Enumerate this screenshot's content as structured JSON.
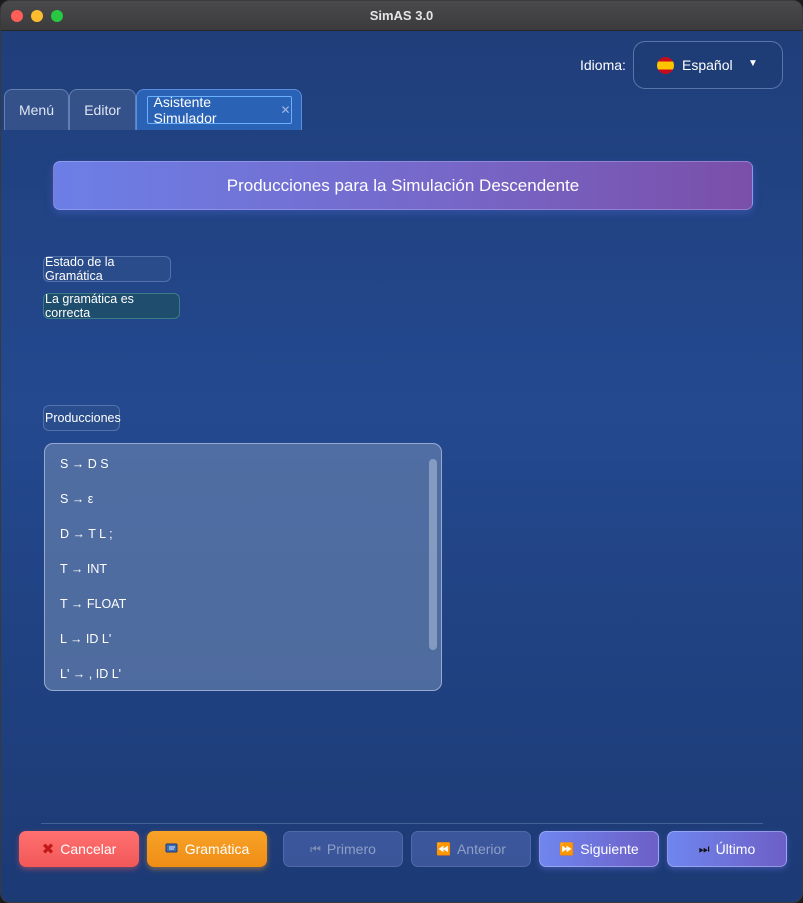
{
  "window": {
    "title": "SimAS 3.0"
  },
  "language": {
    "label": "Idioma:",
    "value": "Español",
    "flag_icon": "spain-flag-icon"
  },
  "tabs": [
    {
      "label": "Menú"
    },
    {
      "label": "Editor"
    },
    {
      "label": "Asistente Simulador",
      "active": true
    }
  ],
  "header": {
    "title": "Producciones para la Simulación Descendente"
  },
  "grammar_state": {
    "label": "Estado de la Gramática",
    "status": "La gramática es correcta"
  },
  "productions": {
    "label": "Producciones",
    "items": [
      "S → D S",
      "S → ε",
      "D → T L ;",
      "T → INT",
      "T → FLOAT",
      "L → ID L'",
      "L' → , ID L'"
    ]
  },
  "buttons": {
    "cancel": "Cancelar",
    "grammar": "Gramática",
    "first": "Primero",
    "previous": "Anterior",
    "next": "Siguiente",
    "last": "Último"
  },
  "colors": {
    "background": "#24498f",
    "cancel": "#f25858",
    "grammar": "#ef8d15",
    "accent": "#6f86ee"
  }
}
